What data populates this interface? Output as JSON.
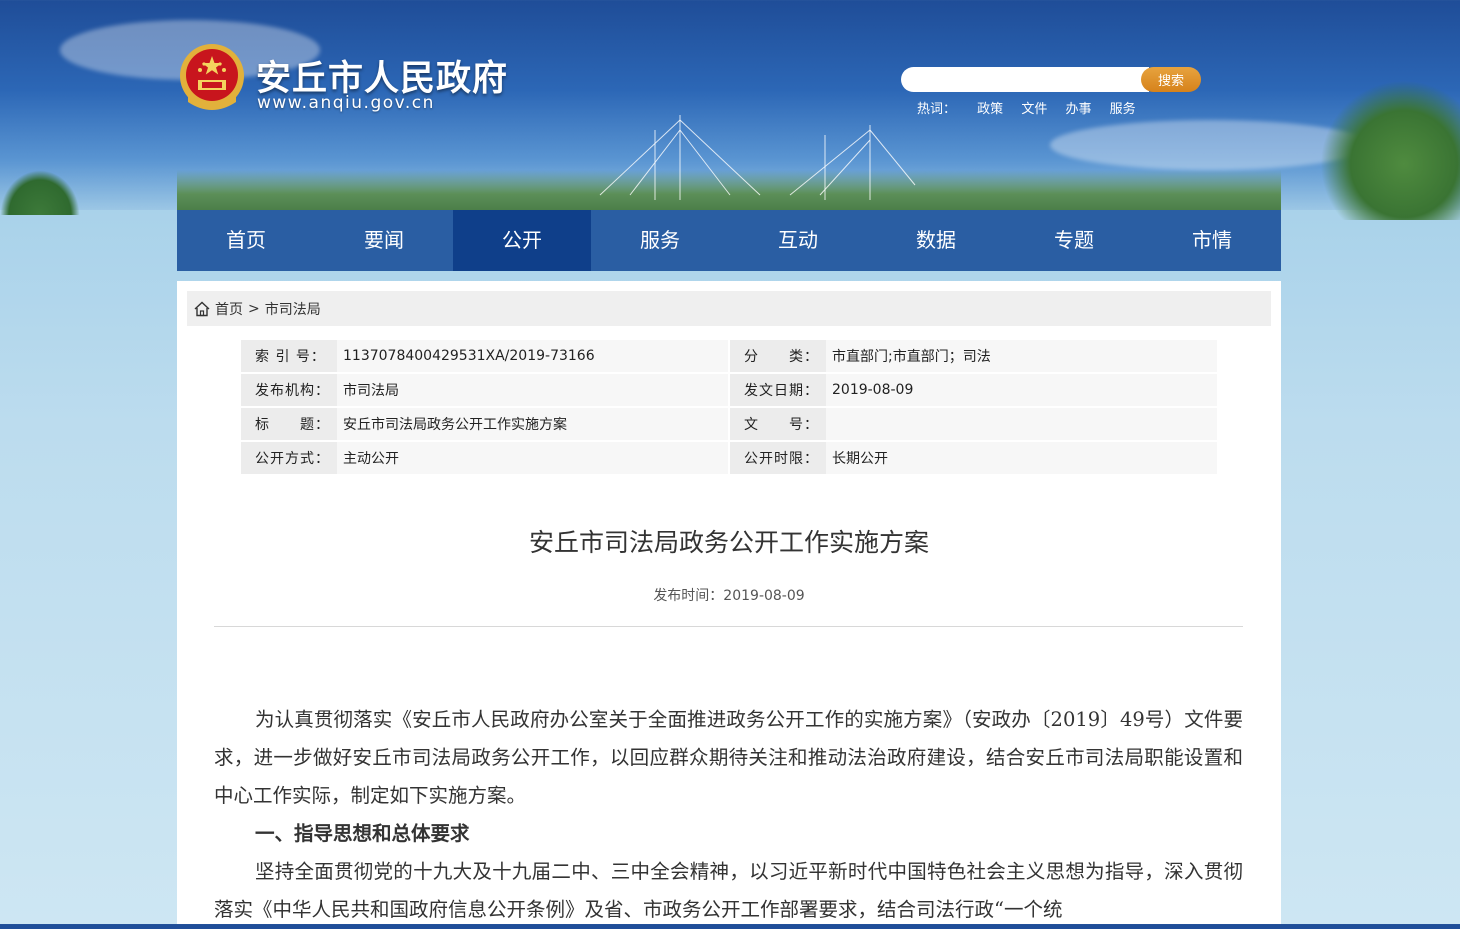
{
  "site": {
    "title": "安丘市人民政府",
    "domain": "www.anqiu.gov.cn"
  },
  "search": {
    "placeholder": "",
    "button_label": "搜索",
    "hot_label": "热词：",
    "hot_words": [
      "政策",
      "文件",
      "办事",
      "服务"
    ]
  },
  "nav": {
    "items": [
      "首页",
      "要闻",
      "公开",
      "服务",
      "互动",
      "数据",
      "专题",
      "市情"
    ],
    "active": "公开"
  },
  "breadcrumb": {
    "home": "首页",
    "separator": ">",
    "current": "市司法局"
  },
  "meta": {
    "index_label": "索 引 号：",
    "index_value": "1137078400429531XA/2019-73166",
    "category_label": "分　　类：",
    "category_value": "市直部门;市直部门；司法",
    "issuer_label": "发布机构：",
    "issuer_value": "市司法局",
    "date_label": "发文日期：",
    "date_value": "2019-08-09",
    "title_label": "标　　题：",
    "title_value": "安丘市司法局政务公开工作实施方案",
    "docno_label": "文　　号：",
    "docno_value": "",
    "method_label": "公开方式：",
    "method_value": "主动公开",
    "period_label": "公开时限：",
    "period_value": "长期公开"
  },
  "article": {
    "title": "安丘市司法局政务公开工作实施方案",
    "pubtime": "发布时间：2019-08-09",
    "para1": "为认真贯彻落实《安丘市人民政府办公室关于全面推进政务公开工作的实施方案》（安政办〔2019〕49号）文件要求，进一步做好安丘市司法局政务公开工作，以回应群众期待关注和推动法治政府建设，结合安丘市司法局职能设置和中心工作实际，制定如下实施方案。",
    "heading1": "一、指导思想和总体要求",
    "para2": "坚持全面贯彻党的十九大及十九届二中、三中全会精神，以习近平新时代中国特色社会主义思想为指导，深入贯彻落实《中华人民共和国政府信息公开条例》及省、市政务公开工作部署要求，结合司法行政“一个统"
  },
  "colors": {
    "nav_bg": "#2a5ea3",
    "nav_active": "#0f3f8a",
    "search_button": "#d6821b"
  }
}
